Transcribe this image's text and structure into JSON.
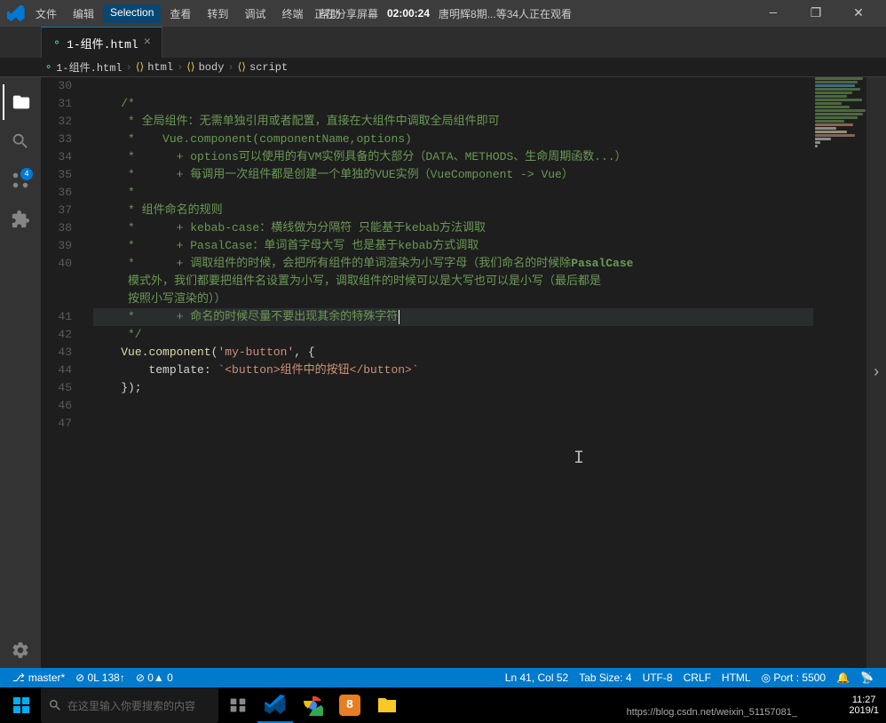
{
  "titlebar": {
    "menus": [
      "文件",
      "编辑",
      "Selection",
      "查看",
      "转到",
      "调试",
      "终端",
      "帮助"
    ],
    "active_menu": "Selection",
    "share_text": "正在分享屏幕",
    "time": "02:00:24",
    "user": "唐明辉8期...等34人正在观看",
    "minimize": "—",
    "restore": "❐",
    "close": "✕"
  },
  "tab": {
    "label": "1-组件.html",
    "modified": true
  },
  "breadcrumb": {
    "items": [
      "1-组件.html",
      "html",
      "body",
      "script"
    ]
  },
  "editor": {
    "lines": [
      {
        "num": 30,
        "content": ""
      },
      {
        "num": 31,
        "content": "    /*"
      },
      {
        "num": 32,
        "content": "     * 全局组件：无需单独引用或者配置，直接在大组件中调取全局组件即可"
      },
      {
        "num": 33,
        "content": "     *    Vue.component(componentName,options)"
      },
      {
        "num": 34,
        "content": "     *      + options可以使用的有VM实例具备的大部分（DATA、METHODS、生命周期函数...）"
      },
      {
        "num": 35,
        "content": "     *      + 每调用一次组件都是创建一个单独的VUE实例（VueComponent -> Vue）"
      },
      {
        "num": 36,
        "content": "     *"
      },
      {
        "num": 37,
        "content": "     * 组件命名的规则"
      },
      {
        "num": 38,
        "content": "     *      + kebab-case：横线做为分隔符 只能基于kebab方法调取"
      },
      {
        "num": 39,
        "content": "     *      + PasalCase：单词首字母大写 也是基于kebab方式调取"
      },
      {
        "num": 40,
        "content": "     *      + 调取组件的时候，会把所有组件的单词渲染为小写字母（我们命名的时候除PasalCase"
      },
      {
        "num": 40,
        "content_cont": "     模式外，我们都要把组件名设置为小写，调取组件的时候可以是大写也可以是小写（最后都是"
      },
      {
        "num": 40,
        "content_cont2": "     按照小写渲染的））"
      },
      {
        "num": 41,
        "content": "     *      + 命名的时候尽量不要出现其余的特殊字符"
      },
      {
        "num": 42,
        "content": "     */"
      },
      {
        "num": 43,
        "content": "    Vue.component('my-button', {"
      },
      {
        "num": 44,
        "content": "        template: `<button>组件中的按钮</button>`"
      },
      {
        "num": 45,
        "content": "    });"
      },
      {
        "num": 46,
        "content": ""
      },
      {
        "num": 47,
        "content": ""
      }
    ]
  },
  "statusbar": {
    "branch": "master*",
    "errors": "⊘ 0L 138↑",
    "warnings": "⊘ 0▲ 0",
    "position": "Ln 41, Col 52",
    "tab_size": "Tab Size: 4",
    "encoding": "UTF-8",
    "line_ending": "CRLF",
    "language": "HTML",
    "port": "◎ Port : 5500",
    "bell": "🔔",
    "broadcast": "📡"
  },
  "taskbar": {
    "url": "https://blog.csdn.net/weixin_51157081_",
    "time": "11:27",
    "date": "2019/1"
  }
}
